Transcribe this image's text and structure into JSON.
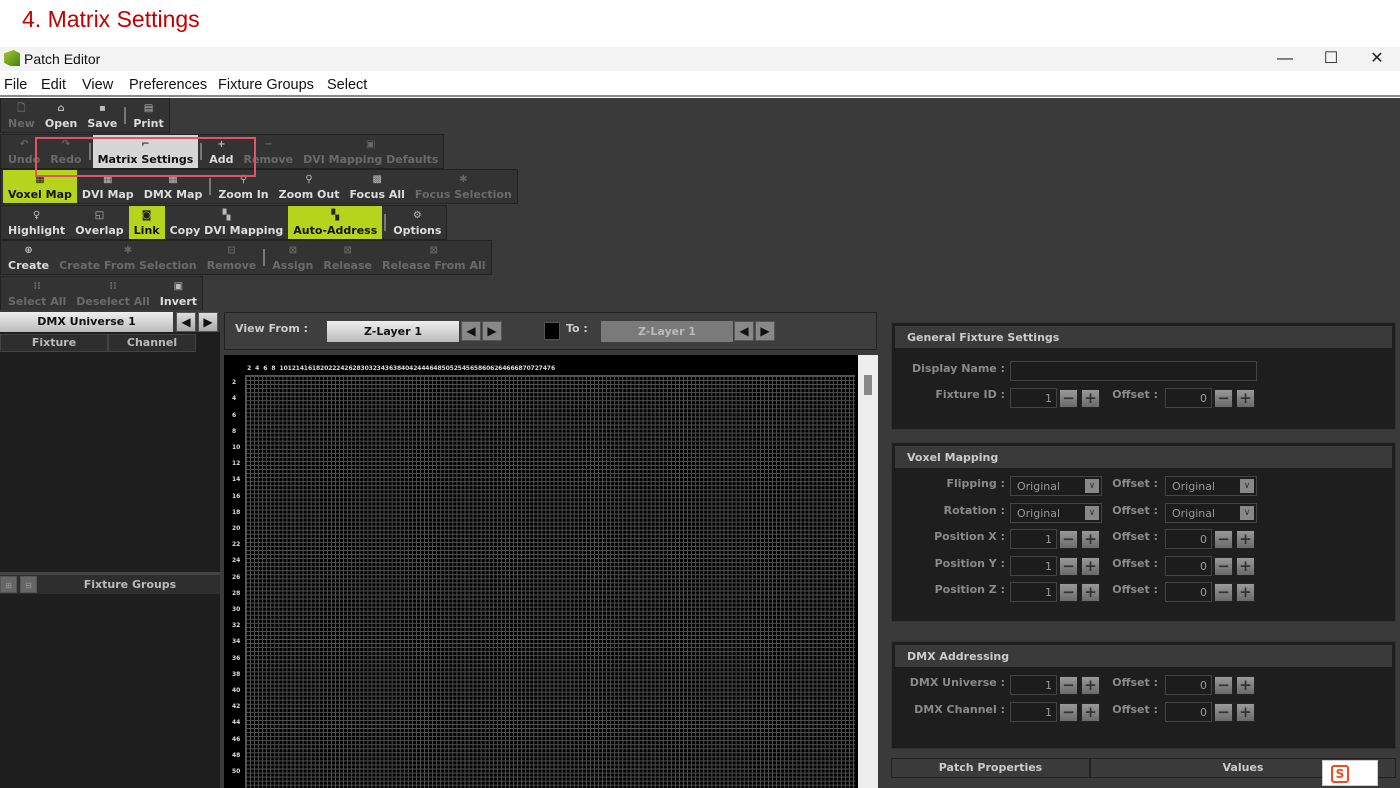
{
  "heading": "4. Matrix Settings",
  "window": {
    "title": "Patch Editor",
    "minimize": "—",
    "maximize": "☐",
    "close": "✕"
  },
  "menu": [
    "File",
    "Edit",
    "View",
    "Preferences",
    "Fixture Groups",
    "Select"
  ],
  "toolbar": [
    {
      "width_end": 164,
      "items": [
        {
          "label": "New",
          "icon": "file-icon",
          "state": "disabled"
        },
        {
          "label": "Open",
          "icon": "folder-icon",
          "state": "normal"
        },
        {
          "label": "Save",
          "icon": "save-icon",
          "state": "normal"
        },
        {
          "sep": true
        },
        {
          "label": "Print",
          "icon": "print-icon",
          "state": "normal"
        }
      ]
    },
    {
      "items": [
        {
          "label": "Undo",
          "icon": "undo-icon",
          "state": "disabled"
        },
        {
          "label": "Redo",
          "icon": "redo-icon",
          "state": "disabled"
        },
        {
          "sep": true
        },
        {
          "label": "Matrix Settings",
          "icon": "matrix-settings-icon",
          "state": "pressed"
        },
        {
          "sep": true
        },
        {
          "label": "Add",
          "icon": "plus-icon",
          "state": "normal"
        },
        {
          "label": "Remove",
          "icon": "minus-icon",
          "state": "disabled"
        },
        {
          "label": "DVI Mapping Defaults",
          "icon": "dvi-defaults-icon",
          "state": "disabled"
        }
      ]
    },
    {
      "items": [
        {
          "label": "Voxel Map",
          "icon": "voxel-map-icon",
          "state": "active"
        },
        {
          "label": "DVI Map",
          "icon": "dvi-map-icon",
          "state": "normal"
        },
        {
          "label": "DMX Map",
          "icon": "dmx-map-icon",
          "state": "normal"
        },
        {
          "sep": true
        },
        {
          "label": "Zoom In",
          "icon": "zoom-in-icon",
          "state": "normal"
        },
        {
          "label": "Zoom Out",
          "icon": "zoom-out-icon",
          "state": "normal"
        },
        {
          "label": "Focus All",
          "icon": "focus-all-icon",
          "state": "normal"
        },
        {
          "label": "Focus Selection",
          "icon": "focus-selection-icon",
          "state": "disabled"
        }
      ]
    },
    {
      "items": [
        {
          "label": "Highlight",
          "icon": "highlight-icon",
          "state": "normal"
        },
        {
          "label": "Overlap",
          "icon": "overlap-icon",
          "state": "normal"
        },
        {
          "label": "Link",
          "icon": "link-icon",
          "state": "active"
        },
        {
          "label": "Copy DVI Mapping",
          "icon": "copy-dvi-icon",
          "state": "normal"
        },
        {
          "label": "Auto-Address",
          "icon": "auto-address-icon",
          "state": "active"
        },
        {
          "sep": true
        },
        {
          "label": "Options",
          "icon": "gear-icon",
          "state": "normal"
        }
      ]
    },
    {
      "items": [
        {
          "label": "Create",
          "icon": "create-icon",
          "state": "normal"
        },
        {
          "label": "Create From Selection",
          "icon": "create-selection-icon",
          "state": "disabled"
        },
        {
          "label": "Remove",
          "icon": "remove-icon",
          "state": "disabled"
        },
        {
          "sep": true
        },
        {
          "label": "Assign",
          "icon": "assign-icon",
          "state": "disabled"
        },
        {
          "label": "Release",
          "icon": "release-icon",
          "state": "disabled"
        },
        {
          "label": "Release From All",
          "icon": "release-all-icon",
          "state": "disabled"
        }
      ]
    },
    {
      "items": [
        {
          "label": "Select All",
          "icon": "select-all-icon",
          "state": "disabled"
        },
        {
          "label": "Deselect All",
          "icon": "deselect-all-icon",
          "state": "disabled"
        },
        {
          "label": "Invert",
          "icon": "invert-icon",
          "state": "normal"
        }
      ]
    }
  ],
  "left": {
    "universe": "DMX Universe 1",
    "columns": [
      "Fixture",
      "Channel"
    ],
    "fixture_groups": "Fixture Groups"
  },
  "view": {
    "from_label": "View From :",
    "from_value": "Z-Layer 1",
    "to_label": "To :",
    "to_value": "Z-Layer 1"
  },
  "grid": {
    "col_ticks_max": 76,
    "row_ticks_max": 50,
    "tick_step": 2
  },
  "right": {
    "general": {
      "title": "General Fixture Settings",
      "display_name_label": "Display Name :",
      "display_name_value": "",
      "fixture_id_label": "Fixture ID :",
      "fixture_id": "1",
      "offset_label": "Offset :",
      "offset": "0"
    },
    "voxel": {
      "title": "Voxel Mapping",
      "rows": [
        {
          "label": "Flipping :",
          "type": "select",
          "value": "Original",
          "offset_label": "Offset :",
          "offset": "Original"
        },
        {
          "label": "Rotation :",
          "type": "select",
          "value": "Original",
          "offset_label": "Offset :",
          "offset": "Original"
        },
        {
          "label": "Position X :",
          "type": "spin",
          "value": "1",
          "offset_label": "Offset :",
          "offset": "0"
        },
        {
          "label": "Position Y :",
          "type": "spin",
          "value": "1",
          "offset_label": "Offset :",
          "offset": "0"
        },
        {
          "label": "Position Z :",
          "type": "spin",
          "value": "1",
          "offset_label": "Offset :",
          "offset": "0"
        }
      ]
    },
    "dmx": {
      "title": "DMX Addressing",
      "rows": [
        {
          "label": "DMX Universe :",
          "type": "spin",
          "value": "1",
          "offset_label": "Offset :",
          "offset": "0"
        },
        {
          "label": "DMX Channel :",
          "type": "spin",
          "value": "1",
          "offset_label": "Offset :",
          "offset": "0"
        }
      ]
    },
    "patch_columns": [
      "Patch Properties",
      "Values"
    ]
  },
  "colors": {
    "accent": "#b6d41c",
    "highlight_box": "#e05565",
    "heading": "#c00000"
  }
}
